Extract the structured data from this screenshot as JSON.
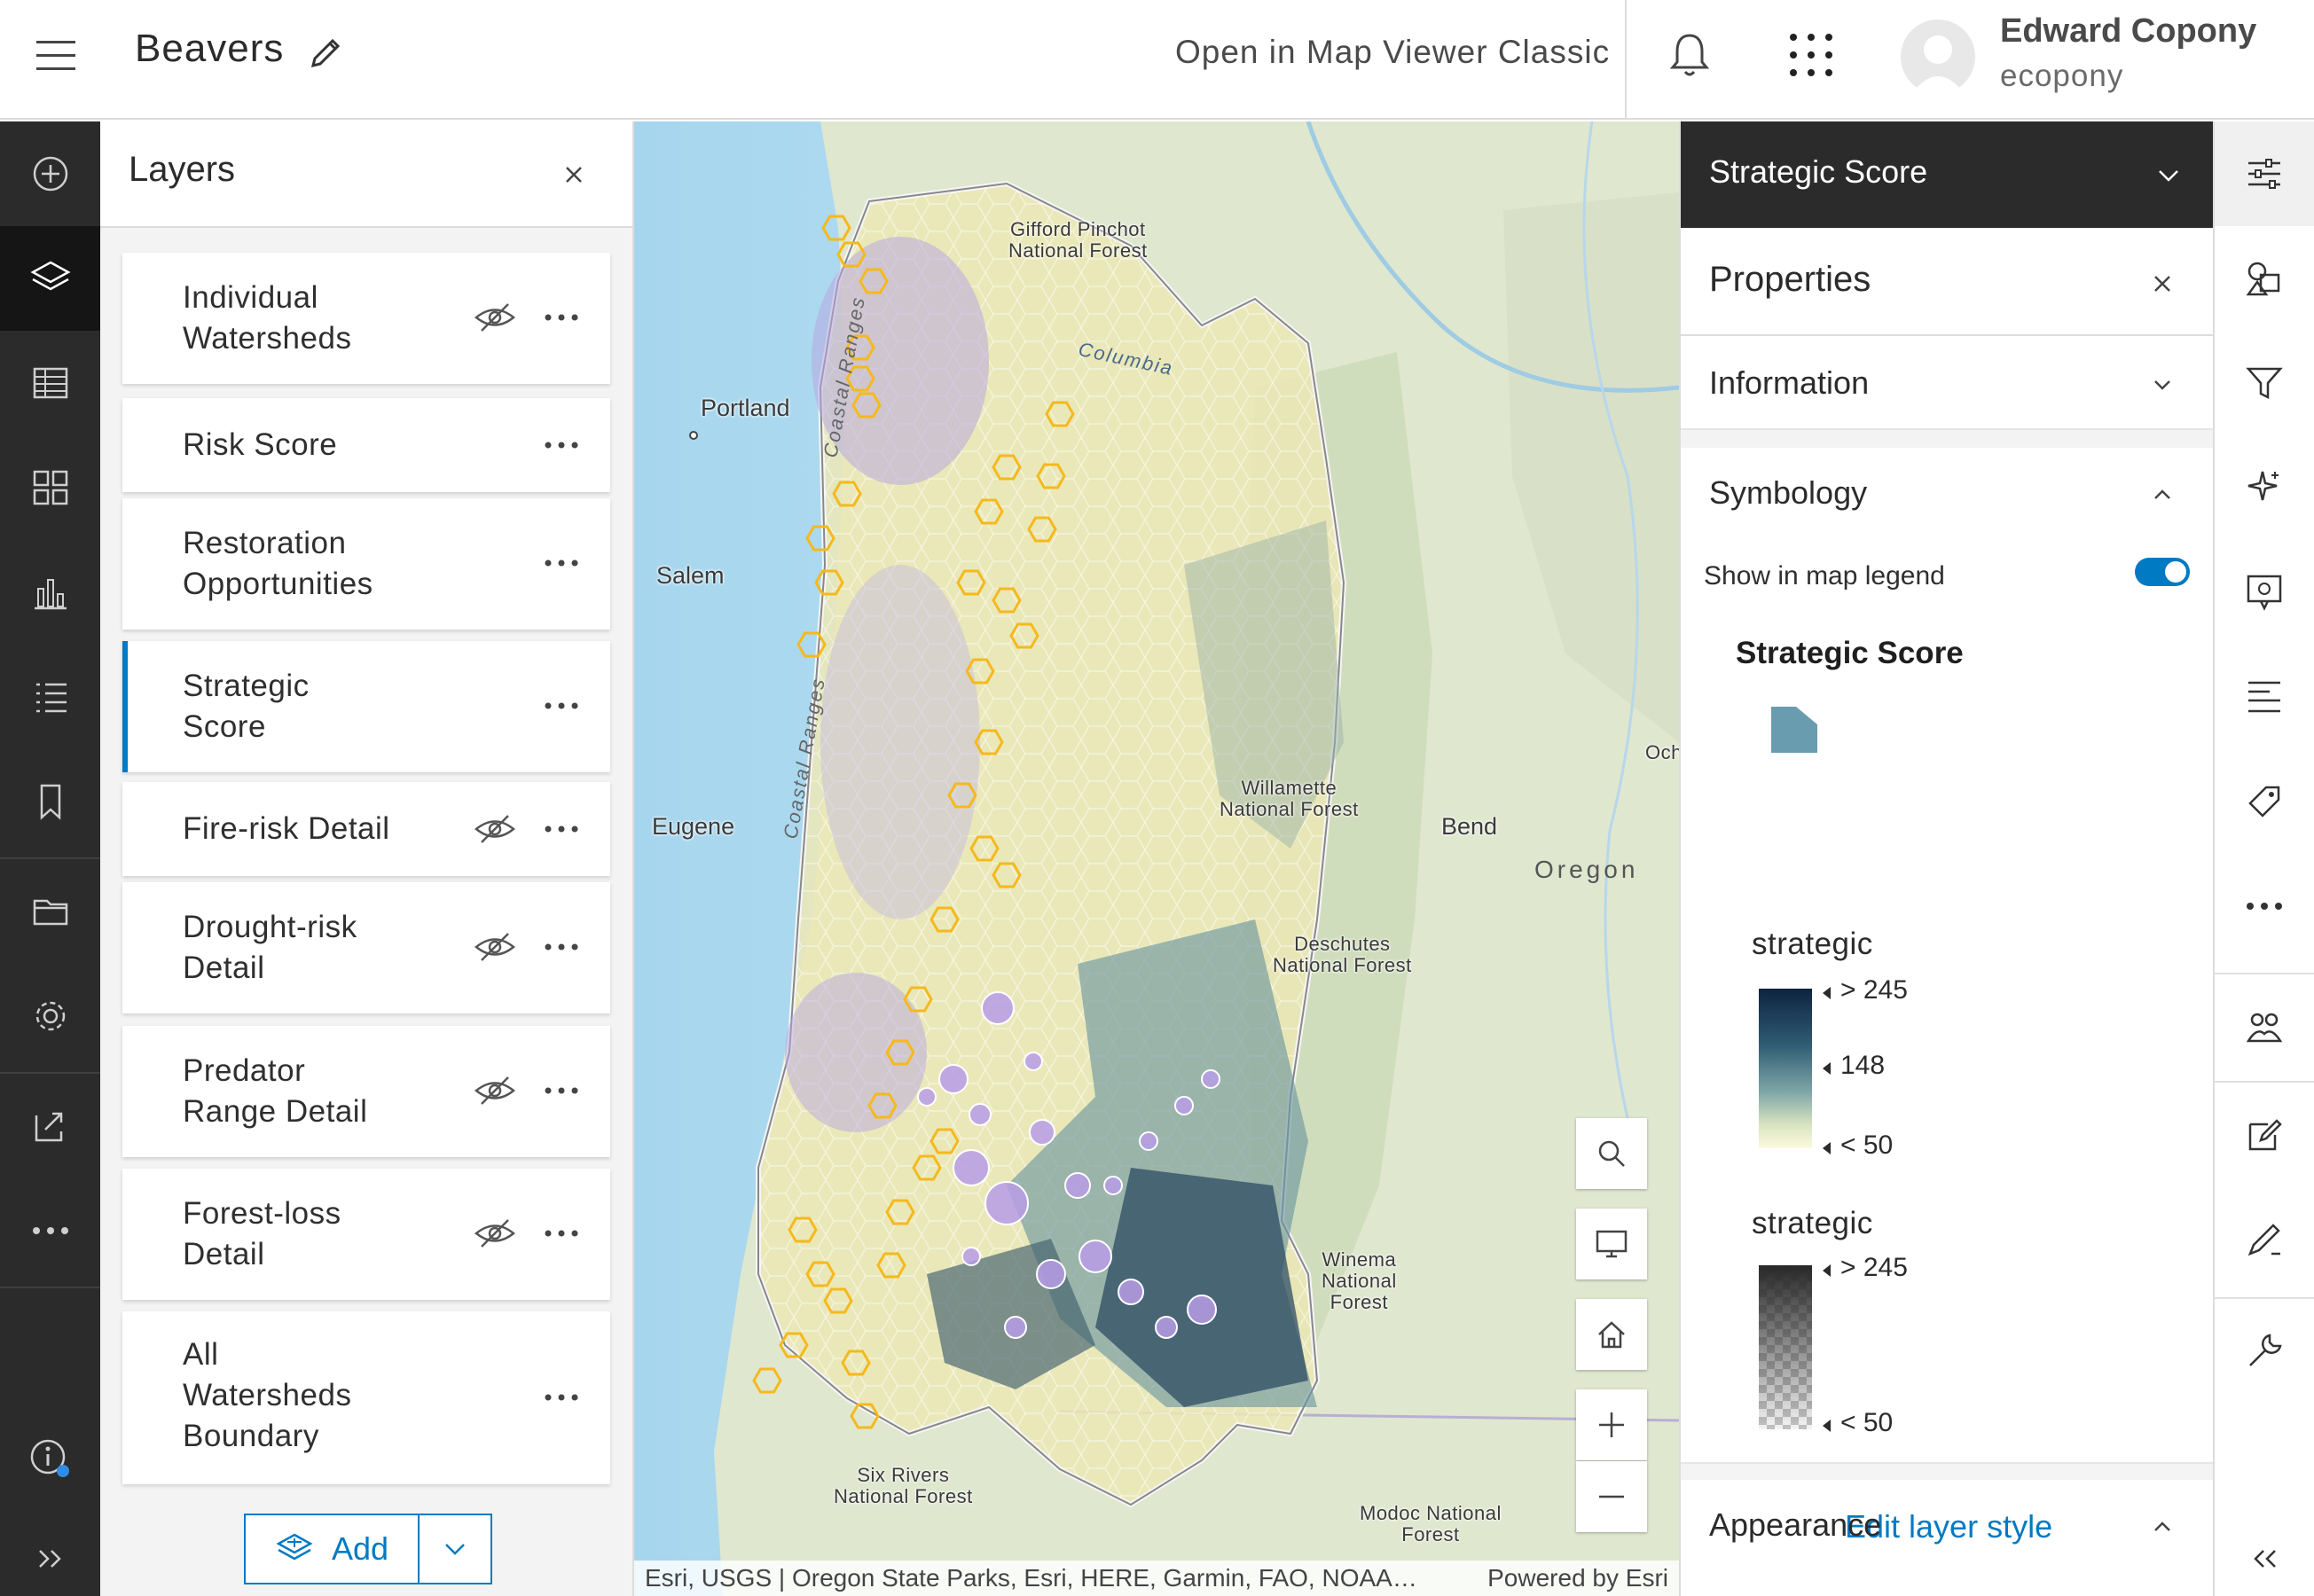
{
  "header": {
    "title": "Beavers",
    "open_classic": "Open in Map Viewer Classic",
    "user_name": "Edward Copony",
    "user_id": "ecopony"
  },
  "left_rail": {
    "items": [
      "add-icon",
      "layers-icon",
      "table-icon",
      "widgets-icon",
      "chart-icon",
      "legend-list-icon",
      "bookmark-icon",
      "folder-icon",
      "settings-icon",
      "share-icon",
      "more-icon",
      "info-icon",
      "expand-icon"
    ]
  },
  "layers_panel": {
    "title": "Layers",
    "add_label": "Add",
    "layers": [
      {
        "label_1": "Individual",
        "label_2": "Watersheds",
        "label_3": "",
        "hidden": true
      },
      {
        "label_1": "Risk Score",
        "label_2": "",
        "label_3": "",
        "hidden": false
      },
      {
        "label_1": "Restoration",
        "label_2": "Opportunities",
        "label_3": "",
        "hidden": false
      },
      {
        "label_1": "Strategic",
        "label_2": "Score",
        "label_3": "",
        "hidden": false,
        "selected": true
      },
      {
        "label_1": "Fire-risk Detail",
        "label_2": "",
        "label_3": "",
        "hidden": true
      },
      {
        "label_1": "Drought-risk",
        "label_2": "Detail",
        "label_3": "",
        "hidden": true
      },
      {
        "label_1": "Predator",
        "label_2": "Range Detail",
        "label_3": "",
        "hidden": true
      },
      {
        "label_1": "Forest-loss",
        "label_2": "Detail",
        "label_3": "",
        "hidden": true
      },
      {
        "label_1": "All",
        "label_2": "Watersheds",
        "label_3": "Boundary",
        "hidden": false
      }
    ]
  },
  "map": {
    "places": {
      "gifford_1": "Gifford Pinchot",
      "gifford_2": "National Forest",
      "portland": "Portland",
      "salem": "Salem",
      "eugene": "Eugene",
      "bend": "Bend",
      "oregon": "Oregon",
      "och": "Och",
      "willamette_1": "Willamette",
      "willamette_2": "National Forest",
      "deschutes_1": "Deschutes",
      "deschutes_2": "National Forest",
      "winema_1": "Winema",
      "winema_2": "National",
      "winema_3": "Forest",
      "sixrivers_1": "Six Rivers",
      "sixrivers_2": "National Forest",
      "modoc_1": "Modoc National",
      "modoc_2": "Forest",
      "columbia": "Columbia",
      "coastal_ranges": "Coastal Ranges"
    },
    "attribution": "Esri, USGS | Oregon State Parks, Esri, HERE, Garmin, FAO, NOAA…",
    "powered_by": "Powered by Esri",
    "tools": [
      "search-icon",
      "basemap-icon",
      "home-icon",
      "zoom-in-icon",
      "zoom-out-icon"
    ]
  },
  "properties_panel": {
    "layer_dropdown": "Strategic Score",
    "title": "Properties",
    "information": "Information",
    "symbology": "Symbology",
    "show_in_legend": "Show in map legend",
    "show_in_legend_on": true,
    "legend_layer_title": "Strategic Score",
    "field_1": "strategic",
    "field_1_high": "> 245",
    "field_1_mid": "148",
    "field_1_low": "< 50",
    "field_2": "strategic",
    "field_2_high": "> 245",
    "field_2_low": "< 50",
    "edit_style": "Edit layer style",
    "appearance": "Appearance",
    "colors": {
      "swatch": "#6a9cb0",
      "accent": "#007ac2"
    }
  },
  "right_rail": {
    "items": [
      "properties-icon",
      "styles-icon",
      "filter-icon",
      "effects-icon",
      "pop-ups-icon",
      "labels-icon",
      "configure-icon",
      "more-icon",
      "clustering-icon",
      "sketch-icon",
      "measure-icon",
      "analysis-icon",
      "collapse-icon"
    ]
  }
}
